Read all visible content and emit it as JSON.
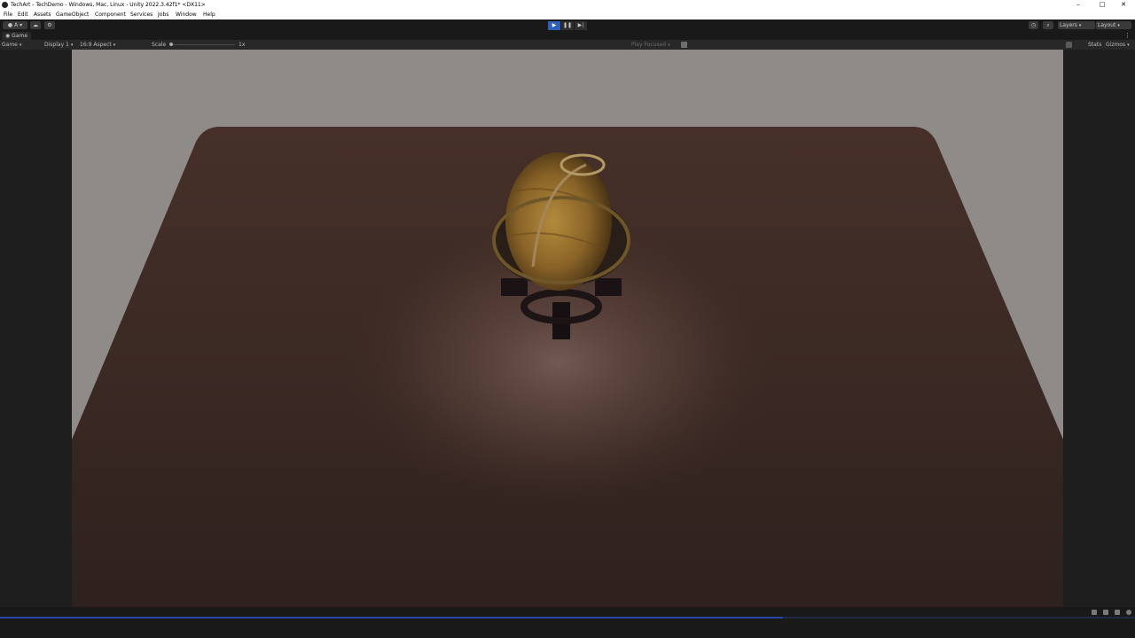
{
  "window": {
    "title": "TechArt - TechDemo - Windows, Mac, Linux - Unity 2022.3.42f1* <DX11>",
    "controls": [
      "–",
      "□",
      "✕"
    ]
  },
  "menu": [
    "File",
    "Edit",
    "Assets",
    "GameObject",
    "Component",
    "Services",
    "Jobs",
    "Window",
    "Help"
  ],
  "toolbar": {
    "account_label": "A",
    "play_controls": [
      "▶",
      "❚❚",
      "▶|"
    ],
    "layers_label": "Layers",
    "layout_label": "Layout"
  },
  "game_tab": {
    "label": "Game"
  },
  "game_bar": {
    "view_select": "Game",
    "display_select": "Display 1",
    "aspect_select": "16:9 Aspect",
    "scale_label": "Scale",
    "scale_value": "1x",
    "play_focused": "Play Focused",
    "stats_label": "Stats",
    "gizmos_label": "Gizmos"
  },
  "status": {
    "progress_fraction": 0.69
  },
  "colors": {
    "play_active": "#2f5fb8",
    "editor_dark": "#191919",
    "panel": "#282828",
    "wall": "#8e8b88",
    "table": "#3a2722"
  },
  "icons": [
    "unity-logo-icon",
    "account-icon",
    "cloud-icon",
    "collab-icon",
    "play-icon",
    "pause-icon",
    "step-icon",
    "history-icon",
    "search-icon",
    "audio-mute-icon",
    "stats-icon",
    "gizmos-icon",
    "kebab-menu-icon"
  ]
}
